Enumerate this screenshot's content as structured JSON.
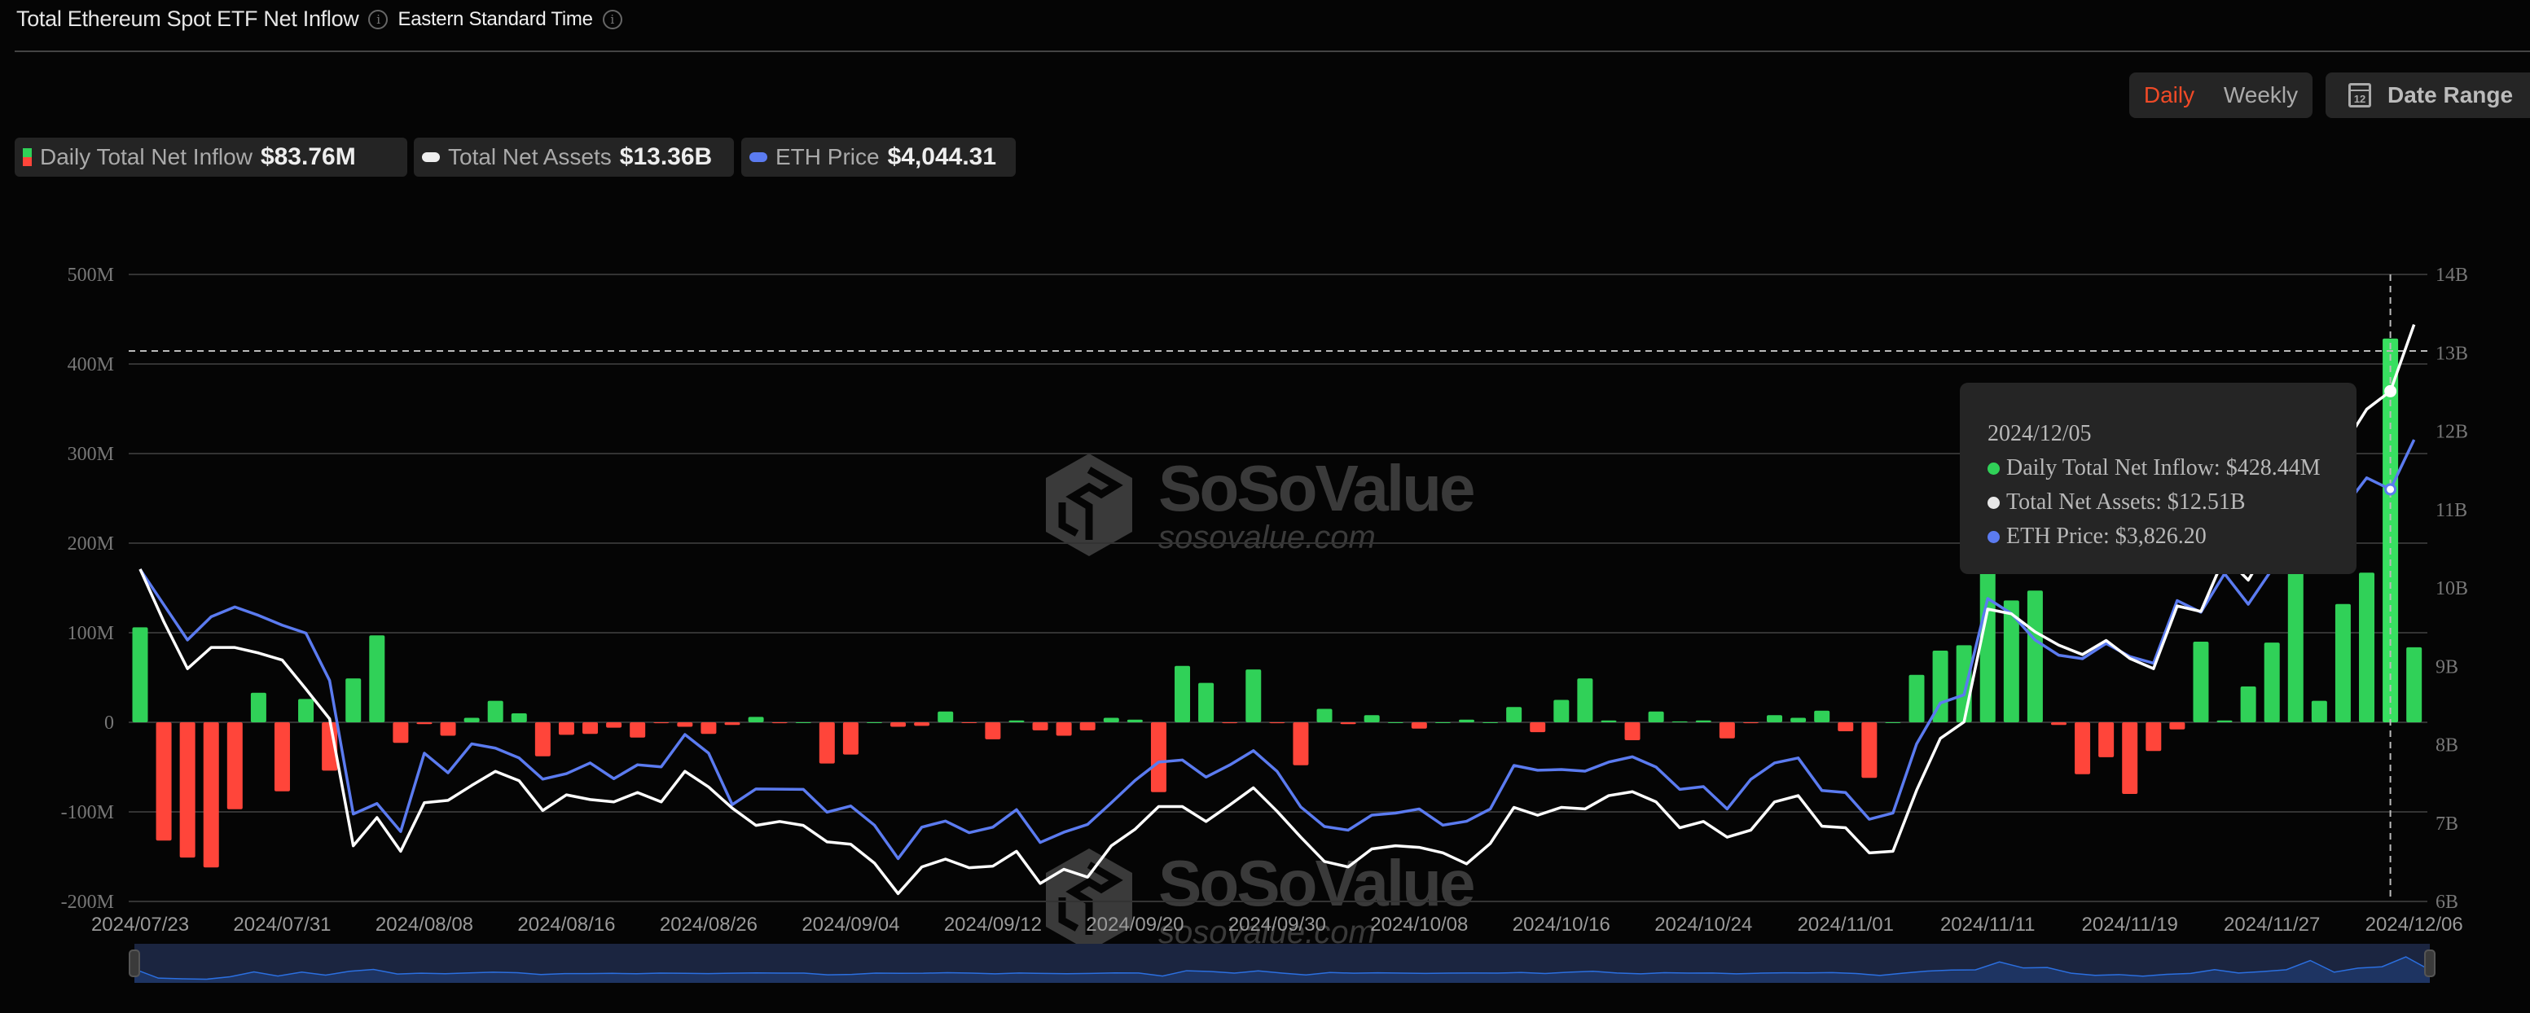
{
  "header": {
    "title": "Total Ethereum Spot ETF Net Inflow",
    "timezone": "Eastern Standard Time",
    "info_icon": "info-circle-icon"
  },
  "controls": {
    "daily": "Daily",
    "weekly": "Weekly",
    "date_range": "Date Range",
    "calendar_icon": "calendar-icon",
    "calendar_day": "12",
    "active_color": "#f04a27"
  },
  "legend": [
    {
      "label": "Daily Total Net Inflow",
      "value": "$83.76M"
    },
    {
      "label": "Total Net Assets",
      "value": "$13.36B"
    },
    {
      "label": "ETH Price",
      "value": "$4,044.31"
    }
  ],
  "tooltip": {
    "date": "2024/12/05",
    "rows": [
      {
        "text": "Daily Total Net Inflow: $428.44M",
        "color": "#30d158"
      },
      {
        "text": "Total Net Assets: $12.51B",
        "color": "#e8e8e8"
      },
      {
        "text": "ETH Price: $3,826.20",
        "color": "#5b7bf0"
      }
    ]
  },
  "watermark": {
    "brand": "SoSoValue",
    "url": "sosovalue.com"
  },
  "chart_data": {
    "type": "bar+line",
    "colors": {
      "positive": "#30d158",
      "negative": "#ff453a",
      "net_assets": "#ffffff",
      "eth_price": "#5b7bf0",
      "grid": "#333333"
    },
    "left_axis": {
      "ticks": [
        "500M",
        "400M",
        "300M",
        "200M",
        "100M",
        "0",
        "-100M",
        "-200M"
      ],
      "range_musd": [
        -200,
        500
      ]
    },
    "right_axis": {
      "ticks": [
        "14B",
        "13B",
        "12B",
        "11B",
        "10B",
        "9B",
        "8B",
        "7B",
        "6B"
      ],
      "range_busd": [
        6,
        14
      ]
    },
    "x_tick_labels": [
      "2024/07/23",
      "2024/07/31",
      "2024/08/08",
      "2024/08/16",
      "2024/08/26",
      "2024/09/04",
      "2024/09/12",
      "2024/09/20",
      "2024/09/30",
      "2024/10/08",
      "2024/10/16",
      "2024/10/24",
      "2024/11/01",
      "2024/11/11",
      "2024/11/19",
      "2024/11/27",
      "2024/12/06"
    ],
    "grid": true,
    "highlighted_date": "2024/12/05",
    "dates": [
      "2024/07/23",
      "2024/07/24",
      "2024/07/25",
      "2024/07/26",
      "2024/07/29",
      "2024/07/30",
      "2024/07/31",
      "2024/08/01",
      "2024/08/02",
      "2024/08/05",
      "2024/08/06",
      "2024/08/07",
      "2024/08/08",
      "2024/08/09",
      "2024/08/12",
      "2024/08/13",
      "2024/08/14",
      "2024/08/15",
      "2024/08/16",
      "2024/08/19",
      "2024/08/20",
      "2024/08/21",
      "2024/08/22",
      "2024/08/23",
      "2024/08/26",
      "2024/08/27",
      "2024/08/28",
      "2024/08/29",
      "2024/08/30",
      "2024/09/03",
      "2024/09/04",
      "2024/09/05",
      "2024/09/06",
      "2024/09/09",
      "2024/09/10",
      "2024/09/11",
      "2024/09/12",
      "2024/09/13",
      "2024/09/16",
      "2024/09/17",
      "2024/09/18",
      "2024/09/19",
      "2024/09/20",
      "2024/09/23",
      "2024/09/24",
      "2024/09/25",
      "2024/09/26",
      "2024/09/27",
      "2024/09/30",
      "2024/10/01",
      "2024/10/02",
      "2024/10/03",
      "2024/10/04",
      "2024/10/07",
      "2024/10/08",
      "2024/10/09",
      "2024/10/10",
      "2024/10/11",
      "2024/10/14",
      "2024/10/15",
      "2024/10/16",
      "2024/10/17",
      "2024/10/18",
      "2024/10/21",
      "2024/10/22",
      "2024/10/23",
      "2024/10/24",
      "2024/10/25",
      "2024/10/28",
      "2024/10/29",
      "2024/10/30",
      "2024/10/31",
      "2024/11/01",
      "2024/11/04",
      "2024/11/05",
      "2024/11/06",
      "2024/11/07",
      "2024/11/08",
      "2024/11/11",
      "2024/11/12",
      "2024/11/13",
      "2024/11/14",
      "2024/11/15",
      "2024/11/18",
      "2024/11/19",
      "2024/11/20",
      "2024/11/21",
      "2024/11/22",
      "2024/11/25",
      "2024/11/26",
      "2024/11/27",
      "2024/11/29",
      "2024/12/02",
      "2024/12/03",
      "2024/12/04",
      "2024/12/05",
      "2024/12/06"
    ],
    "series": [
      {
        "name": "Daily Total Net Inflow",
        "unit": "M USD",
        "values": [
          106,
          -132,
          -151,
          -162,
          -97,
          33,
          -77,
          26,
          -54,
          49,
          97,
          -23,
          -2,
          -15,
          5,
          24,
          10,
          -38,
          -14,
          -13,
          -6,
          -17,
          -1,
          -5,
          -13,
          -3,
          6,
          -1,
          0,
          -46,
          -36,
          0,
          -5,
          -4,
          12,
          -0.5,
          -19,
          2,
          -9,
          -15,
          -9,
          5,
          3,
          -78,
          63,
          44,
          -1,
          59,
          -1,
          -48,
          15,
          -2,
          8,
          0,
          -7,
          0,
          3,
          0,
          17,
          -11,
          25,
          49,
          2,
          -20,
          12,
          1,
          2,
          -18,
          -1,
          8,
          5,
          13,
          -10,
          -62,
          0,
          53,
          80,
          86,
          295,
          136,
          147,
          -3,
          -58,
          -39,
          -80,
          -32,
          -8,
          90,
          2,
          40,
          89,
          333,
          24,
          132,
          167,
          428.44,
          83.76
        ]
      },
      {
        "name": "Total Net Assets",
        "unit": "B USD",
        "values": [
          10.24,
          9.57,
          8.97,
          9.24,
          9.24,
          9.17,
          9.08,
          8.71,
          8.33,
          6.71,
          7.07,
          6.64,
          7.26,
          7.29,
          7.48,
          7.66,
          7.54,
          7.16,
          7.36,
          7.3,
          7.27,
          7.39,
          7.27,
          7.66,
          7.46,
          7.19,
          6.97,
          7.02,
          6.97,
          6.76,
          6.73,
          6.49,
          6.1,
          6.44,
          6.54,
          6.43,
          6.45,
          6.64,
          6.23,
          6.41,
          6.31,
          6.71,
          6.92,
          7.21,
          7.21,
          7.02,
          7.23,
          7.45,
          7.15,
          6.82,
          6.51,
          6.44,
          6.67,
          6.71,
          6.69,
          6.62,
          6.48,
          6.74,
          7.2,
          7.1,
          7.2,
          7.18,
          7.35,
          7.4,
          7.27,
          6.94,
          7.02,
          6.82,
          6.91,
          7.27,
          7.35,
          6.96,
          6.94,
          6.62,
          6.64,
          7.42,
          8.08,
          8.29,
          9.73,
          9.67,
          9.44,
          9.27,
          9.15,
          9.33,
          9.1,
          8.97,
          9.77,
          9.7,
          10.4,
          10.1,
          10.6,
          11.3,
          11.5,
          11.8,
          12.28,
          12.51,
          13.36
        ]
      },
      {
        "name": "ETH Price",
        "unit": "USD",
        "values": [
          3475,
          3320,
          3165,
          3267,
          3310,
          3273,
          3230,
          3195,
          2987,
          2401,
          2447,
          2324,
          2668,
          2582,
          2709,
          2690,
          2647,
          2554,
          2578,
          2625,
          2556,
          2617,
          2608,
          2750,
          2668,
          2442,
          2511,
          2510,
          2509,
          2409,
          2436,
          2352,
          2205,
          2343,
          2370,
          2319,
          2343,
          2420,
          2276,
          2321,
          2355,
          2450,
          2548,
          2629,
          2638,
          2563,
          2616,
          2679,
          2588,
          2432,
          2346,
          2330,
          2396,
          2405,
          2423,
          2352,
          2369,
          2423,
          2614,
          2593,
          2596,
          2589,
          2629,
          2652,
          2607,
          2509,
          2521,
          2423,
          2553,
          2625,
          2647,
          2504,
          2495,
          2378,
          2405,
          2709,
          2888,
          2924,
          3347,
          3281,
          3165,
          3098,
          3083,
          3150,
          3092,
          3063,
          3338,
          3287,
          3456,
          3322,
          3475,
          3590,
          3660,
          3740,
          3877,
          3826.2,
          4044.31
        ]
      }
    ]
  }
}
